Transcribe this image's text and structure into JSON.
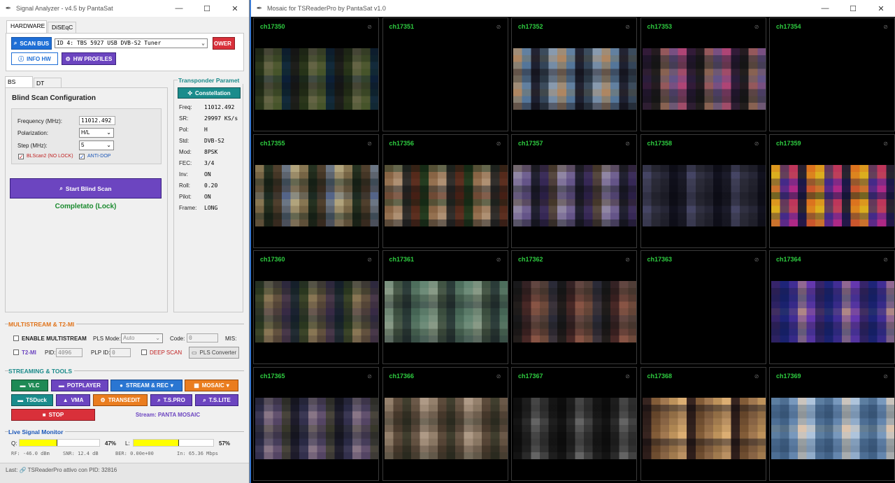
{
  "left_window": {
    "title": "Signal Analyzer - v4.5 by PantaSat",
    "tabs": [
      "HARDWARE",
      "DiSEqC"
    ],
    "hardware": {
      "scan_bus": "SCAN BUS",
      "tuner_select": "ID 4: TBS 5927 USB DVB-S2 Tuner",
      "power_btn": "OWER",
      "info_hw": "INFO HW",
      "hw_profiles": "HW PROFILES"
    },
    "mode_tabs": [
      "BS Mode",
      "DT Mode"
    ],
    "blind_scan": {
      "title": "Blind Scan Configuration",
      "freq_label": "Frequency (MHz):",
      "freq_value": "11012.492",
      "pol_label": "Polarization:",
      "pol_value": "H/L",
      "step_label": "Step (MHz):",
      "step_value": "5",
      "blscan2_label": "BLScan2 (NO LOCK)",
      "antidop_label": "ANTI-DOP",
      "start_btn": "Start Blind Scan",
      "status": "Completato (Lock)"
    },
    "transponder": {
      "title": "Transponder Paramet",
      "constellation_btn": "Constellation",
      "params": [
        {
          "k": "Freq:",
          "v": "11012.492"
        },
        {
          "k": "SR:",
          "v": "29997 KS/s"
        },
        {
          "k": "Pol:",
          "v": "H"
        },
        {
          "k": "Std:",
          "v": "DVB-S2"
        },
        {
          "k": "Mod:",
          "v": "8PSK"
        },
        {
          "k": "FEC:",
          "v": "3/4"
        },
        {
          "k": "Inv:",
          "v": "ON"
        },
        {
          "k": "Roll:",
          "v": "0.20"
        },
        {
          "k": "Pilot:",
          "v": "ON"
        },
        {
          "k": "Frame:",
          "v": "LONG"
        }
      ]
    },
    "multistream": {
      "title": "MULTISTREAM & T2-MI",
      "enable_label": "ENABLE MULTISTREAM",
      "pls_mode_label": "PLS Mode:",
      "pls_mode_value": "Auto",
      "code_label": "Code:",
      "code_value": "0",
      "mis_label": "MIS:",
      "t2mi_label": "T2-MI",
      "pid_label": "PID:",
      "pid_value": "4096",
      "plp_label": "PLP ID:",
      "plp_value": "0",
      "deep_scan_label": "DEEP SCAN",
      "pls_converter": "PLS Converter"
    },
    "streaming": {
      "title": "STREAMING & TOOLS",
      "vlc": "VLC",
      "potplayer": "POTPLAYER",
      "stream_rec": "STREAM & REC",
      "mosaic": "MOSAIC",
      "tsduck": "TSDuck",
      "vma": "VMA",
      "transedit": "TRANSEDIT",
      "tspro": "T.S.PRO",
      "tslite": "T.S.LITE",
      "stop": "STOP",
      "stream_status": "Stream: PANTA MOSAIC"
    },
    "monitor": {
      "title": "Live Signal Monitor",
      "q_label": "Q:",
      "q_percent": "47%",
      "q_value": 0.47,
      "l_label": "L:",
      "l_percent": "57%",
      "l_value": 0.57,
      "rf": "RF: -46.0 dBm",
      "snr": "SNR: 12.4 dB",
      "ber": "BER: 0.00e+00",
      "in": "In: 65.36 Mbps"
    },
    "status_bar": "Last: 🔗 TSReaderPro attivo con PID: 32816",
    "colors": {
      "scan_blue": "#1f6fd6",
      "power_red": "#d9303a",
      "purple": "#6c45c0",
      "green_dark": "#1e8a55",
      "teal": "#1a8c8c",
      "orange": "#ea7d1f",
      "blue_stream": "#2a76d2",
      "stop_red": "#d9303a",
      "status_green": "#1a8a2e"
    }
  },
  "right_window": {
    "title": "Mosaic for TSReaderPro by PantaSat v1.0",
    "channels": [
      "ch17350",
      "ch17351",
      "ch17352",
      "ch17353",
      "ch17354",
      "ch17355",
      "ch17356",
      "ch17357",
      "ch17358",
      "ch17359",
      "ch17360",
      "ch17361",
      "ch17362",
      "ch17363",
      "ch17364",
      "ch17365",
      "ch17366",
      "ch17367",
      "ch17368",
      "ch17369"
    ]
  }
}
